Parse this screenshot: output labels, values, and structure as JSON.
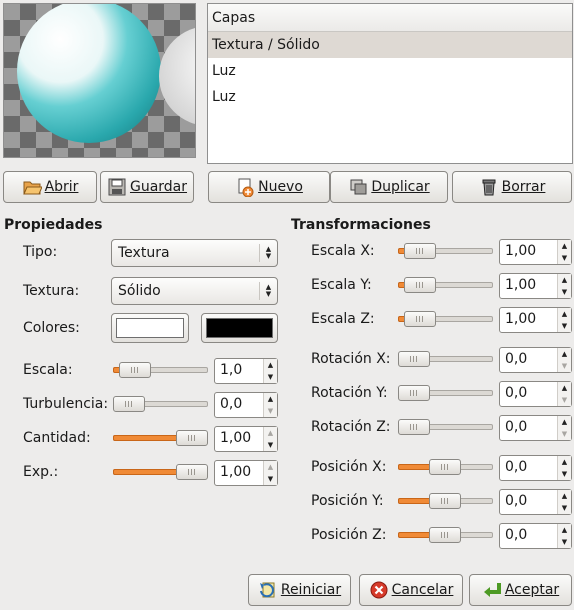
{
  "layers": {
    "header": "Capas",
    "items": [
      "Textura / Sólido",
      "Luz",
      "Luz"
    ]
  },
  "buttons": {
    "open": "Abrir",
    "save": "Guardar",
    "new": "Nuevo",
    "duplicate": "Duplicar",
    "delete": "Borrar",
    "reset": "Reiniciar",
    "cancel": "Cancelar",
    "accept": "Aceptar"
  },
  "properties": {
    "title": "Propiedades",
    "type_label": "Tipo:",
    "type_value": "Textura",
    "texture_label": "Textura:",
    "texture_value": "Sólido",
    "colors_label": "Colores:",
    "color1": "#ffffff",
    "color2": "#000000",
    "scale_label": "Escala:",
    "scale_value": "1,0",
    "turbulence_label": "Turbulencia:",
    "turbulence_value": "0,0",
    "amount_label": "Cantidad:",
    "amount_value": "1,00",
    "exp_label": "Exp.:",
    "exp_value": "1,00"
  },
  "transforms": {
    "title": "Transformaciones",
    "scale_x_label": "Escala X:",
    "scale_x_value": "1,00",
    "scale_y_label": "Escala Y:",
    "scale_y_value": "1,00",
    "scale_z_label": "Escala Z:",
    "scale_z_value": "1,00",
    "rot_x_label": "Rotación X:",
    "rot_x_value": "0,0",
    "rot_y_label": "Rotación Y:",
    "rot_y_value": "0,0",
    "rot_z_label": "Rotación Z:",
    "rot_z_value": "0,0",
    "pos_x_label": "Posición X:",
    "pos_x_value": "0,0",
    "pos_y_label": "Posición Y:",
    "pos_y_value": "0,0",
    "pos_z_label": "Posición Z:",
    "pos_z_value": "0,0"
  },
  "colors": {
    "accent": "#f08a36",
    "selection": "#ded9d3",
    "sphere": "#3bbcc0"
  }
}
